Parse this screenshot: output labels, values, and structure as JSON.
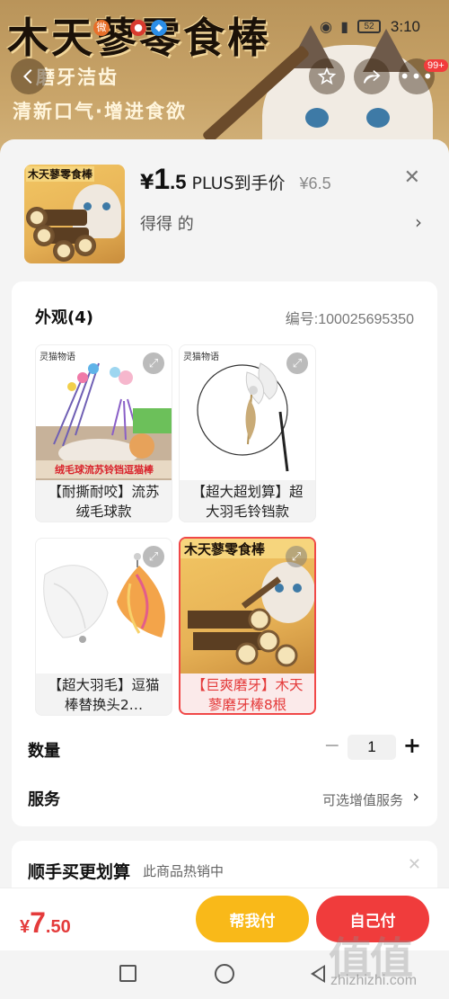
{
  "banner": {
    "title": "木天蓼零食棒",
    "sub1": "磨牙洁齿",
    "sub2": "清新口气·增进食欲"
  },
  "status_bar": {
    "time": "3:10",
    "battery": "52"
  },
  "nav": {
    "message_badge": "99+"
  },
  "header": {
    "thumb_title": "木天蓼零食棒",
    "price_currency": "¥",
    "price_int": "1",
    "price_dec": ".5",
    "price_label": "PLUS到手价",
    "original_price": "¥6.5",
    "variant_text": "得得  的"
  },
  "appearance": {
    "title": "外观(4)",
    "code": "编号:100025695350",
    "options": [
      {
        "label": "【耐撕耐咬】流苏绒毛球款",
        "brand": "灵猫物语",
        "caption": "绒毛球流苏铃铛逗猫棒",
        "selected": false
      },
      {
        "label": "【超大超划算】超大羽毛铃铛款",
        "brand": "灵猫物语",
        "selected": false
      },
      {
        "label": "【超大羽毛】逗猫棒替换头2…",
        "selected": false
      },
      {
        "label": "【巨爽磨牙】木天蓼磨牙棒8根",
        "thumb_title": "木天蓼零食棒",
        "selected": true
      }
    ]
  },
  "quantity": {
    "label": "数量",
    "minus": "−",
    "value": "1",
    "plus": "+"
  },
  "service": {
    "label": "服务",
    "value": "可选增值服务"
  },
  "upsell": {
    "title": "顺手买更划算",
    "subtitle": "此商品热销中"
  },
  "action_bar": {
    "total_currency": "¥",
    "total_int": "7",
    "total_dec": ".50",
    "help_pay_label": "帮我付",
    "self_pay_label": "自己付"
  },
  "watermark": {
    "text": "值值值",
    "url": "zhizhizhi.com"
  },
  "colors": {
    "price_red": "#e43b3b",
    "help_button": "#f9b919",
    "self_button": "#f03c3c"
  }
}
